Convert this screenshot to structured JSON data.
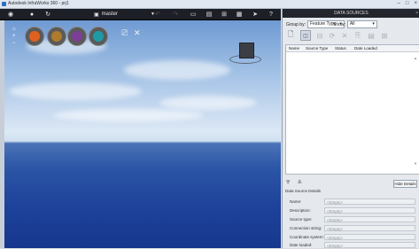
{
  "window": {
    "title": "Autodesk InfraWorks 360 - prj1",
    "controls": [
      "–",
      "□",
      "×"
    ]
  },
  "toolbar": {
    "branch": "master"
  },
  "viewport": {
    "left_icons": [
      "⌂",
      "+",
      "−"
    ]
  },
  "panel": {
    "title": "DATA SOURCES",
    "group_by_label": "Group by:",
    "group_by_value": "Feature Type",
    "show_label": "Show:",
    "show_value": "All",
    "columns": [
      "Name",
      "Source Type",
      "Status",
      "Date Loaded"
    ],
    "hide_details": "Hide Details",
    "details_title": "Data Source Details",
    "details": [
      {
        "label": "Name:",
        "value": "<Empty>"
      },
      {
        "label": "Description:",
        "value": "<Empty>"
      },
      {
        "label": "Source type:",
        "value": "<Empty>"
      },
      {
        "label": "Connection string:",
        "value": "<Empty>"
      },
      {
        "label": "Coordinate system:",
        "value": "<Empty>"
      },
      {
        "label": "Date loaded:",
        "value": "<Empty>"
      }
    ]
  },
  "colors": {
    "layer_orange": "#e0601e",
    "layer_tan": "#b07a2c",
    "layer_purple": "#7e3d96",
    "layer_teal": "#1e9aa6"
  }
}
